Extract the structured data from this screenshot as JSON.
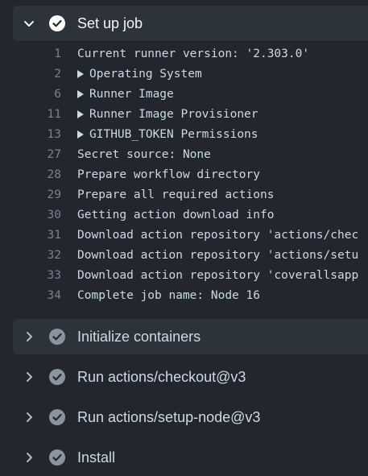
{
  "steps": {
    "setup": {
      "title": "Set up job"
    },
    "init": {
      "title": "Initialize containers"
    },
    "checkout": {
      "title": "Run actions/checkout@v3"
    },
    "setup_node": {
      "title": "Run actions/setup-node@v3"
    },
    "install": {
      "title": "Install"
    }
  },
  "log": [
    {
      "num": "1",
      "text": "Current runner version: '2.303.0'"
    },
    {
      "num": "2",
      "text": "Operating System",
      "expandable": true
    },
    {
      "num": "6",
      "text": "Runner Image",
      "expandable": true
    },
    {
      "num": "11",
      "text": "Runner Image Provisioner",
      "expandable": true
    },
    {
      "num": "13",
      "text": "GITHUB_TOKEN Permissions",
      "expandable": true
    },
    {
      "num": "27",
      "text": "Secret source: None"
    },
    {
      "num": "28",
      "text": "Prepare workflow directory"
    },
    {
      "num": "29",
      "text": "Prepare all required actions"
    },
    {
      "num": "30",
      "text": "Getting action download info"
    },
    {
      "num": "31",
      "text": "Download action repository 'actions/chec"
    },
    {
      "num": "32",
      "text": "Download action repository 'actions/setu"
    },
    {
      "num": "33",
      "text": "Download action repository 'coverallsapp"
    },
    {
      "num": "34",
      "text": "Complete job name: Node 16"
    }
  ],
  "colors": {
    "background": "#22272e",
    "step_header_bg": "#2d333b",
    "check_success": "#ffffff",
    "check_muted": "#8b949e"
  }
}
